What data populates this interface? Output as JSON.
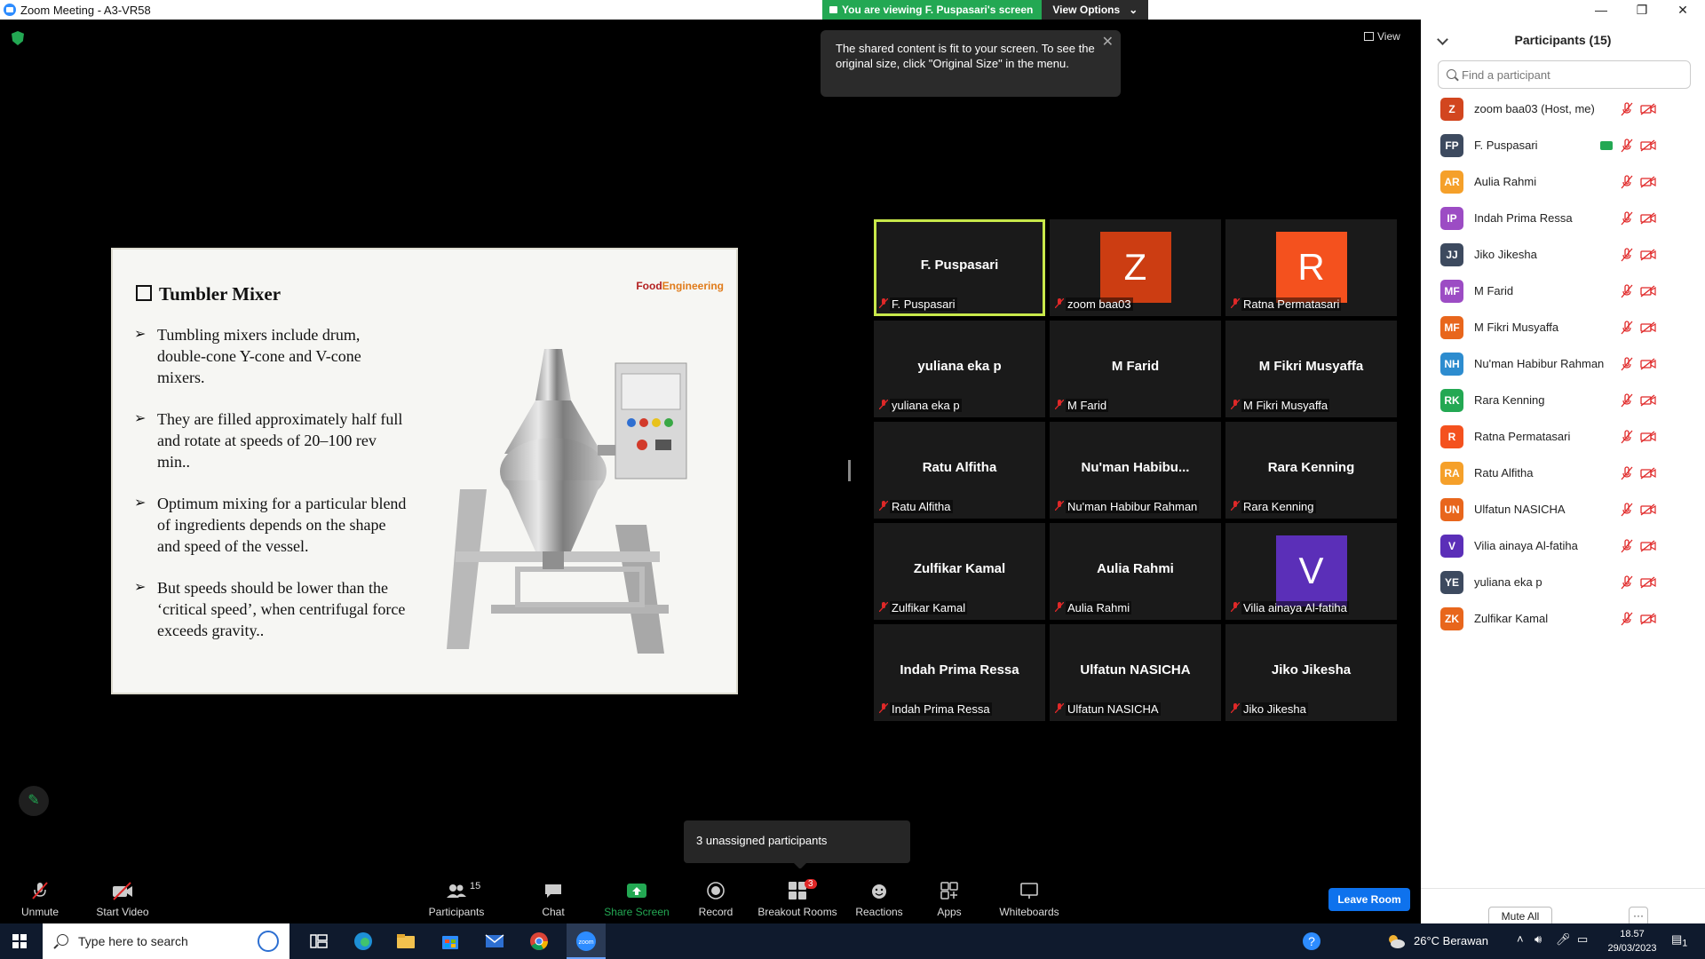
{
  "window": {
    "title": "Zoom Meeting - A3-VR58",
    "minimize": "—",
    "restore": "❐",
    "close": "✕"
  },
  "share_banner": {
    "text": "You are viewing F. Puspasari's screen",
    "options_label": "View Options",
    "options_caret": "⌄"
  },
  "tooltip": {
    "text": "The shared content is fit to your screen. To see the original size, click \"Original Size\" in the menu.",
    "close": "✕"
  },
  "view_button": {
    "label": "View"
  },
  "slide": {
    "title": "Tumbler Mixer",
    "brand_prefix": "Food",
    "brand_suffix": "Engineering",
    "bullets": [
      "Tumbling mixers include drum, double-cone Y-cone and V-cone mixers.",
      "They are filled approximately half full and rotate at speeds of 20–100 rev min..",
      "Optimum mixing for a particular blend of ingredients depends on the shape and speed of the vessel.",
      "But speeds should be lower than the ‘critical speed’, when centrifugal force exceeds gravity.."
    ]
  },
  "gallery": {
    "tiles": [
      {
        "display": "F. Puspasari",
        "label": "F. Puspasari",
        "avatar": "",
        "avatar_color": "",
        "active": true
      },
      {
        "display": "",
        "label": "zoom baa03",
        "avatar": "Z",
        "avatar_color": "#cc3d12",
        "active": false
      },
      {
        "display": "",
        "label": "Ratna Permatasari",
        "avatar": "R",
        "avatar_color": "#f4511e",
        "active": false
      },
      {
        "display": "yuliana eka p",
        "label": "yuliana eka p",
        "avatar": "",
        "avatar_color": "",
        "active": false
      },
      {
        "display": "M Farid",
        "label": "M Farid",
        "avatar": "",
        "avatar_color": "",
        "active": false
      },
      {
        "display": "M Fikri Musyaffa",
        "label": "M Fikri Musyaffa",
        "avatar": "",
        "avatar_color": "",
        "active": false
      },
      {
        "display": "Ratu Alfitha",
        "label": "Ratu Alfitha",
        "avatar": "",
        "avatar_color": "",
        "active": false
      },
      {
        "display": "Nu'man  Habibu...",
        "label": "Nu'man Habibur Rahman",
        "avatar": "",
        "avatar_color": "",
        "active": false
      },
      {
        "display": "Rara Kenning",
        "label": "Rara Kenning",
        "avatar": "",
        "avatar_color": "",
        "active": false
      },
      {
        "display": "Zulfikar Kamal",
        "label": "Zulfikar Kamal",
        "avatar": "",
        "avatar_color": "",
        "active": false
      },
      {
        "display": "Aulia Rahmi",
        "label": "Aulia Rahmi",
        "avatar": "",
        "avatar_color": "",
        "active": false
      },
      {
        "display": "",
        "label": "Vilia ainaya Al-fatiha",
        "avatar": "V",
        "avatar_color": "#5b2fb8",
        "active": false
      },
      {
        "display": "Indah Prima Ressa",
        "label": "Indah Prima Ressa",
        "avatar": "",
        "avatar_color": "",
        "active": false
      },
      {
        "display": "Ulfatun NASICHA",
        "label": "Ulfatun NASICHA",
        "avatar": "",
        "avatar_color": "",
        "active": false
      },
      {
        "display": "Jiko Jikesha",
        "label": "Jiko Jikesha",
        "avatar": "",
        "avatar_color": "",
        "active": false
      }
    ]
  },
  "unassigned": {
    "text": "3 unassigned participants"
  },
  "toolbar": {
    "unmute": "Unmute",
    "start_video": "Start Video",
    "participants": "Participants",
    "participants_count": "15",
    "chat": "Chat",
    "share_screen": "Share Screen",
    "record": "Record",
    "breakout_rooms": "Breakout Rooms",
    "breakout_badge": "3",
    "reactions": "Reactions",
    "apps": "Apps",
    "whiteboards": "Whiteboards",
    "leave": "Leave Room",
    "caret": "^"
  },
  "panel": {
    "title": "Participants (15)",
    "search_placeholder": "Find a participant",
    "mute_all": "Mute All",
    "more": "···",
    "participants": [
      {
        "initials": "Z",
        "name": "zoom baa03 (Host, me)",
        "color": "#d2461f",
        "sharing": false
      },
      {
        "initials": "FP",
        "name": "F. Puspasari",
        "color": "#3d4a5f",
        "sharing": true
      },
      {
        "initials": "AR",
        "name": "Aulia Rahmi",
        "color": "#f5a02a",
        "sharing": false
      },
      {
        "initials": "IP",
        "name": "Indah Prima Ressa",
        "color": "#9c4cc4",
        "sharing": false
      },
      {
        "initials": "JJ",
        "name": "Jiko Jikesha",
        "color": "#3d4a5f",
        "sharing": false
      },
      {
        "initials": "MF",
        "name": "M Farid",
        "color": "#9c4cc4",
        "sharing": false
      },
      {
        "initials": "MF",
        "name": "M Fikri Musyaffa",
        "color": "#e8661c",
        "sharing": false
      },
      {
        "initials": "NH",
        "name": "Nu'man Habibur Rahman",
        "color": "#2d8ccf",
        "sharing": false
      },
      {
        "initials": "RK",
        "name": "Rara Kenning",
        "color": "#23a853",
        "sharing": false
      },
      {
        "initials": "R",
        "name": "Ratna Permatasari",
        "color": "#f4511e",
        "sharing": false
      },
      {
        "initials": "RA",
        "name": "Ratu Alfitha",
        "color": "#f5a02a",
        "sharing": false
      },
      {
        "initials": "UN",
        "name": "Ulfatun NASICHA",
        "color": "#e8661c",
        "sharing": false
      },
      {
        "initials": "V",
        "name": "Vilia ainaya Al-fatiha",
        "color": "#5b2fb8",
        "sharing": false
      },
      {
        "initials": "YE",
        "name": "yuliana eka p",
        "color": "#3d4a5f",
        "sharing": false
      },
      {
        "initials": "ZK",
        "name": "Zulfikar Kamal",
        "color": "#e8661c",
        "sharing": false
      }
    ]
  },
  "taskbar": {
    "search_placeholder": "Type here to search",
    "weather": "26°C  Berawan",
    "time": "18.57",
    "date": "29/03/2023",
    "notifications": "1"
  },
  "colors": {
    "accent": "#0e72ed",
    "share_green": "#23a853",
    "active_speaker": "#c8e84a",
    "muted_red": "#e02828"
  }
}
